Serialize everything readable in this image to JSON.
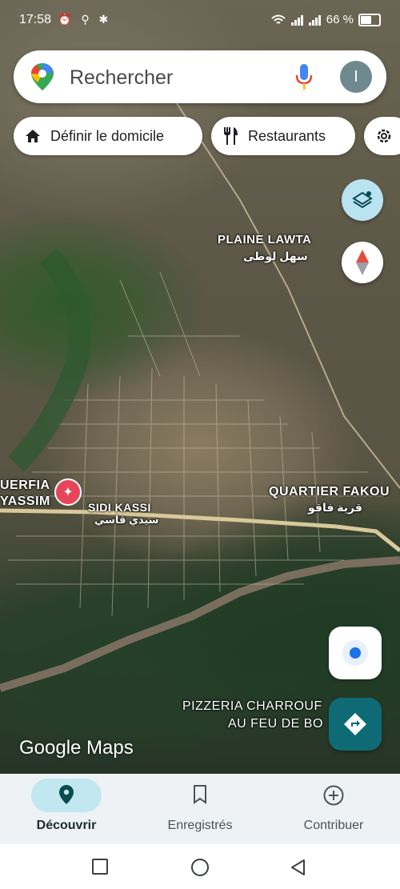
{
  "status_bar": {
    "time": "17:58",
    "left_icons": "⏰ ⚲ ✱",
    "battery_text": "66 %",
    "battery_level": 0.66
  },
  "search": {
    "placeholder": "Rechercher",
    "avatar_letter": "I"
  },
  "chips": [
    {
      "label": "Définir le domicile",
      "icon": "home-icon"
    },
    {
      "label": "Restaurants",
      "icon": "fork-knife-icon"
    },
    {
      "label": "",
      "icon": "gear-icon"
    }
  ],
  "map_labels": {
    "plaine_lawta": "PLAINE LAWTA",
    "plaine_lawta_ar": "سهل لوطى",
    "sidi_kassi": "SIDI KASSI",
    "sidi_kassi_ar": "سيدي قاسي",
    "quartier_fakou": "QUARTIER FAKOU",
    "quartier_fakou_ar": "قرية فاقو",
    "uerfia": "UERFIA",
    "yassim": "YASSIM",
    "pizzeria_line1": "PIZZERIA CHARROUF",
    "pizzeria_line2": "AU FEU DE BO"
  },
  "brand": "Google Maps",
  "bottom_nav": [
    {
      "label": "Découvrir",
      "icon": "location-pin-icon",
      "active": true
    },
    {
      "label": "Enregistrés",
      "icon": "bookmark-icon",
      "active": false
    },
    {
      "label": "Contribuer",
      "icon": "add-circle-icon",
      "active": false
    }
  ],
  "colors": {
    "accent_teal": "#0e6b75",
    "active_pill": "#c1e8f0",
    "poi_red": "#e6455a"
  }
}
